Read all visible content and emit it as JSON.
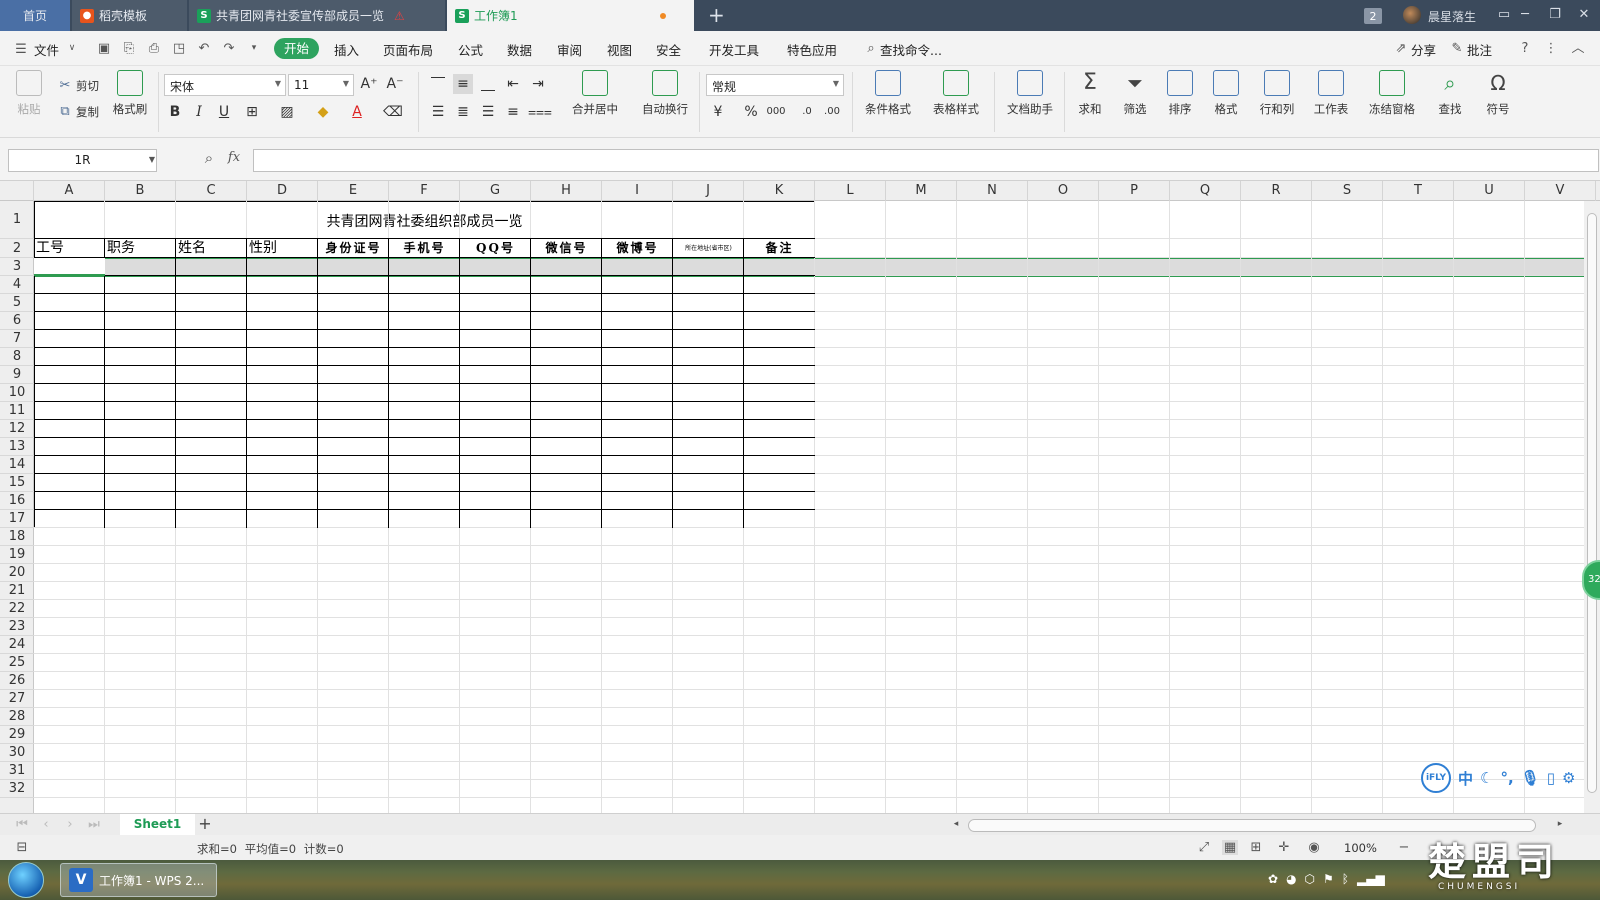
{
  "tabs": [
    {
      "label": "首页"
    },
    {
      "label": "稻壳模板",
      "icon": "fire-icon"
    },
    {
      "label": "共青团网青社委宣传部成员一览",
      "icon": "sheet-icon",
      "warning": "⚠"
    },
    {
      "label": "工作簿1",
      "icon": "sheet-icon",
      "active": true
    }
  ],
  "window": {
    "badge": "2",
    "user": "晨星落生"
  },
  "menu": {
    "file": "文件",
    "items": [
      "开始",
      "插入",
      "页面布局",
      "公式",
      "数据",
      "审阅",
      "视图",
      "安全",
      "开发工具",
      "特色应用"
    ],
    "search": "查找命令...",
    "share": "分享",
    "comment": "批注"
  },
  "ribbon": {
    "paste": "粘贴",
    "cut": "剪切",
    "copy": "复制",
    "format_painter": "格式刷",
    "font_name": "宋体",
    "font_size": "11",
    "merge_center": "合并居中",
    "wrap": "自动换行",
    "number_format": "常规",
    "cond_format": "条件格式",
    "table_style": "表格样式",
    "doc_helper": "文档助手",
    "sum": "求和",
    "filter": "筛选",
    "sort": "排序",
    "format": "格式",
    "rows_cols": "行和列",
    "worksheet": "工作表",
    "freeze": "冻结窗格",
    "find": "查找",
    "symbol": "符号"
  },
  "formula_bar": {
    "name_box": "1R",
    "fx": "fx",
    "value": ""
  },
  "columns": [
    "A",
    "B",
    "C",
    "D",
    "E",
    "F",
    "G",
    "H",
    "I",
    "J",
    "K",
    "L",
    "M",
    "N",
    "O",
    "P",
    "Q",
    "R",
    "S",
    "T",
    "U",
    "V"
  ],
  "rows": [
    "1",
    "2",
    "3",
    "4",
    "5",
    "6",
    "7",
    "8",
    "9",
    "10",
    "11",
    "12",
    "13",
    "14",
    "15",
    "16",
    "17",
    "18",
    "19",
    "20",
    "21",
    "22",
    "23",
    "24",
    "25",
    "26",
    "27",
    "28",
    "29",
    "30",
    "31",
    "32"
  ],
  "sheet": {
    "title": "共青团网青社委组织部成员一览",
    "headers": [
      "工号",
      "职务",
      "姓名",
      "性别",
      "身份证号",
      "手机号",
      "QQ号",
      "微信号",
      "微博号",
      "所在地址(省市区)",
      "备注"
    ]
  },
  "sheet_tabs": {
    "active": "Sheet1",
    "add": "+"
  },
  "status": {
    "text": "求和=0  平均值=0  计数=0",
    "zoom": "100%"
  },
  "taskbar": {
    "app": "工作簿1 - WPS 2..."
  },
  "watermark": {
    "big": "楚盟司",
    "small": "CHUMENGSI"
  },
  "ifly": {
    "logo": "iFLY",
    "lang": "中"
  },
  "float_badge": "32"
}
